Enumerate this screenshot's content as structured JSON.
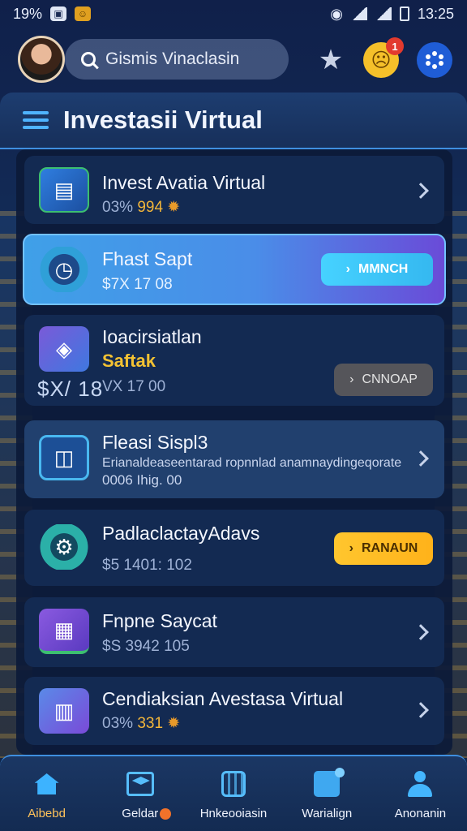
{
  "status_bar": {
    "battery_text": "19%",
    "time": "13:25"
  },
  "header": {
    "search_text": "Gismis Vinaclasin",
    "notification_count": "1"
  },
  "page": {
    "title": "Investasii Virtual"
  },
  "items": [
    {
      "title": "Invest Avatia Virtual",
      "sub_prefix": "03% ",
      "sub_num": "994"
    },
    {
      "title": "Fhast Sapt",
      "sub": "$7X 17 08",
      "button": "MMNCH"
    },
    {
      "title": "Ioacirsiatlan",
      "sub2": "Saftak",
      "side_num": "$X/ 18",
      "sub": "VX 17 00",
      "button": "CNNOAP"
    },
    {
      "title": "Fleasi Sispl3",
      "desc": "Erianaldeaseentarad ropnnlad anamnaydingeqorate",
      "sub": "0006 Ihig. 00"
    },
    {
      "title": "PadlaclactayAdavs",
      "sub": "$5 1401: 102",
      "button": "RANAUN"
    },
    {
      "title": "Fnpne Saycat",
      "sub": "$S 3942 105"
    },
    {
      "title": "Cendiaksian Avestasa Virtual",
      "sub_prefix": "03% ",
      "sub_num": "331"
    }
  ],
  "bottom_nav": [
    {
      "label": "Aibebd",
      "icon": "home-icon",
      "active": true
    },
    {
      "label": "Geldar",
      "icon": "graduation-cap-icon"
    },
    {
      "label": "Hnkeooiasin",
      "icon": "building-icon"
    },
    {
      "label": "Warialign",
      "icon": "clipboard-icon"
    },
    {
      "label": "Anonanin",
      "icon": "user-icon"
    }
  ],
  "colors": {
    "accent_blue": "#3f8fe0",
    "accent_yellow": "#f3b63a",
    "card_bg": "#132a52"
  }
}
